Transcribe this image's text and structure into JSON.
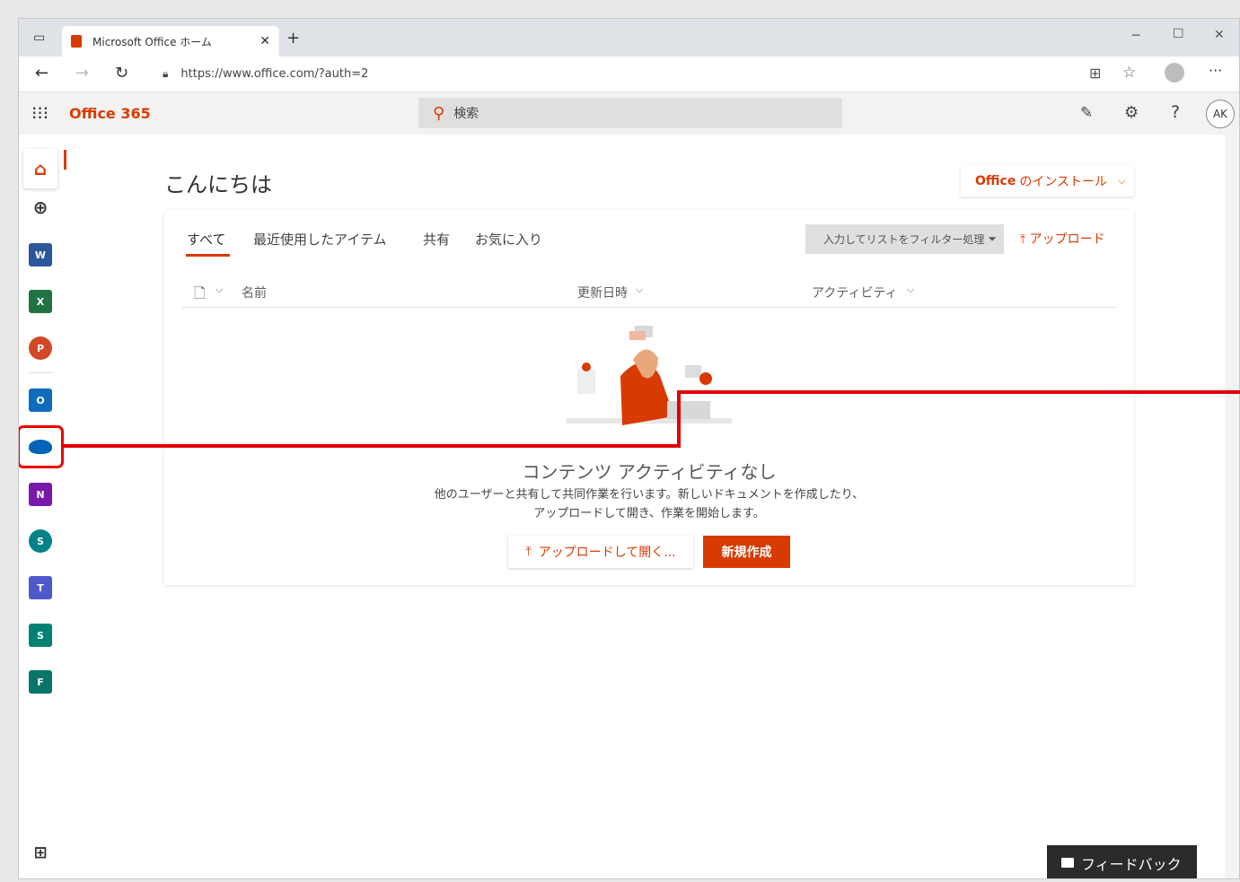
{
  "browser": {
    "tab_title": "Microsoft Office ホーム",
    "url": "https://www.office.com/?auth=2"
  },
  "app": {
    "brand": "Office 365",
    "search_placeholder": "検索",
    "avatar_initials": "AK"
  },
  "main": {
    "greeting": "こんにちは",
    "install_bold": "Office",
    "install_rest": "のインストール",
    "tabs": [
      "すべて",
      "最近使用したアイテム",
      "共有",
      "お気に入り"
    ],
    "filter_placeholder": "入力してリストをフィルター処理",
    "upload_label": "アップロード",
    "columns": {
      "name": "名前",
      "modified": "更新日時",
      "activity": "アクティビティ"
    },
    "empty_title": "コンテンツ アクティビティなし",
    "empty_desc_line1": "他のユーザーと共有して共同作業を行います。新しいドキュメントを作成したり、",
    "empty_desc_line2": "アップロードして開き、作業を開始します。",
    "upload_open_button": "アップロードして開く...",
    "new_button": "新規作成"
  },
  "feedback_label": "フィードバック",
  "rail_colors": {
    "word": "#2b579a",
    "excel": "#217346",
    "powerpoint": "#d24726",
    "outlook": "#0f6cbd",
    "onedrive": "#0364b8",
    "onenote": "#7719aa",
    "sharepoint": "#038387",
    "teams": "#5059c9",
    "sway": "#008272",
    "forms": "#077568"
  },
  "accent": "#d83b01",
  "callout_color": "#e00000"
}
